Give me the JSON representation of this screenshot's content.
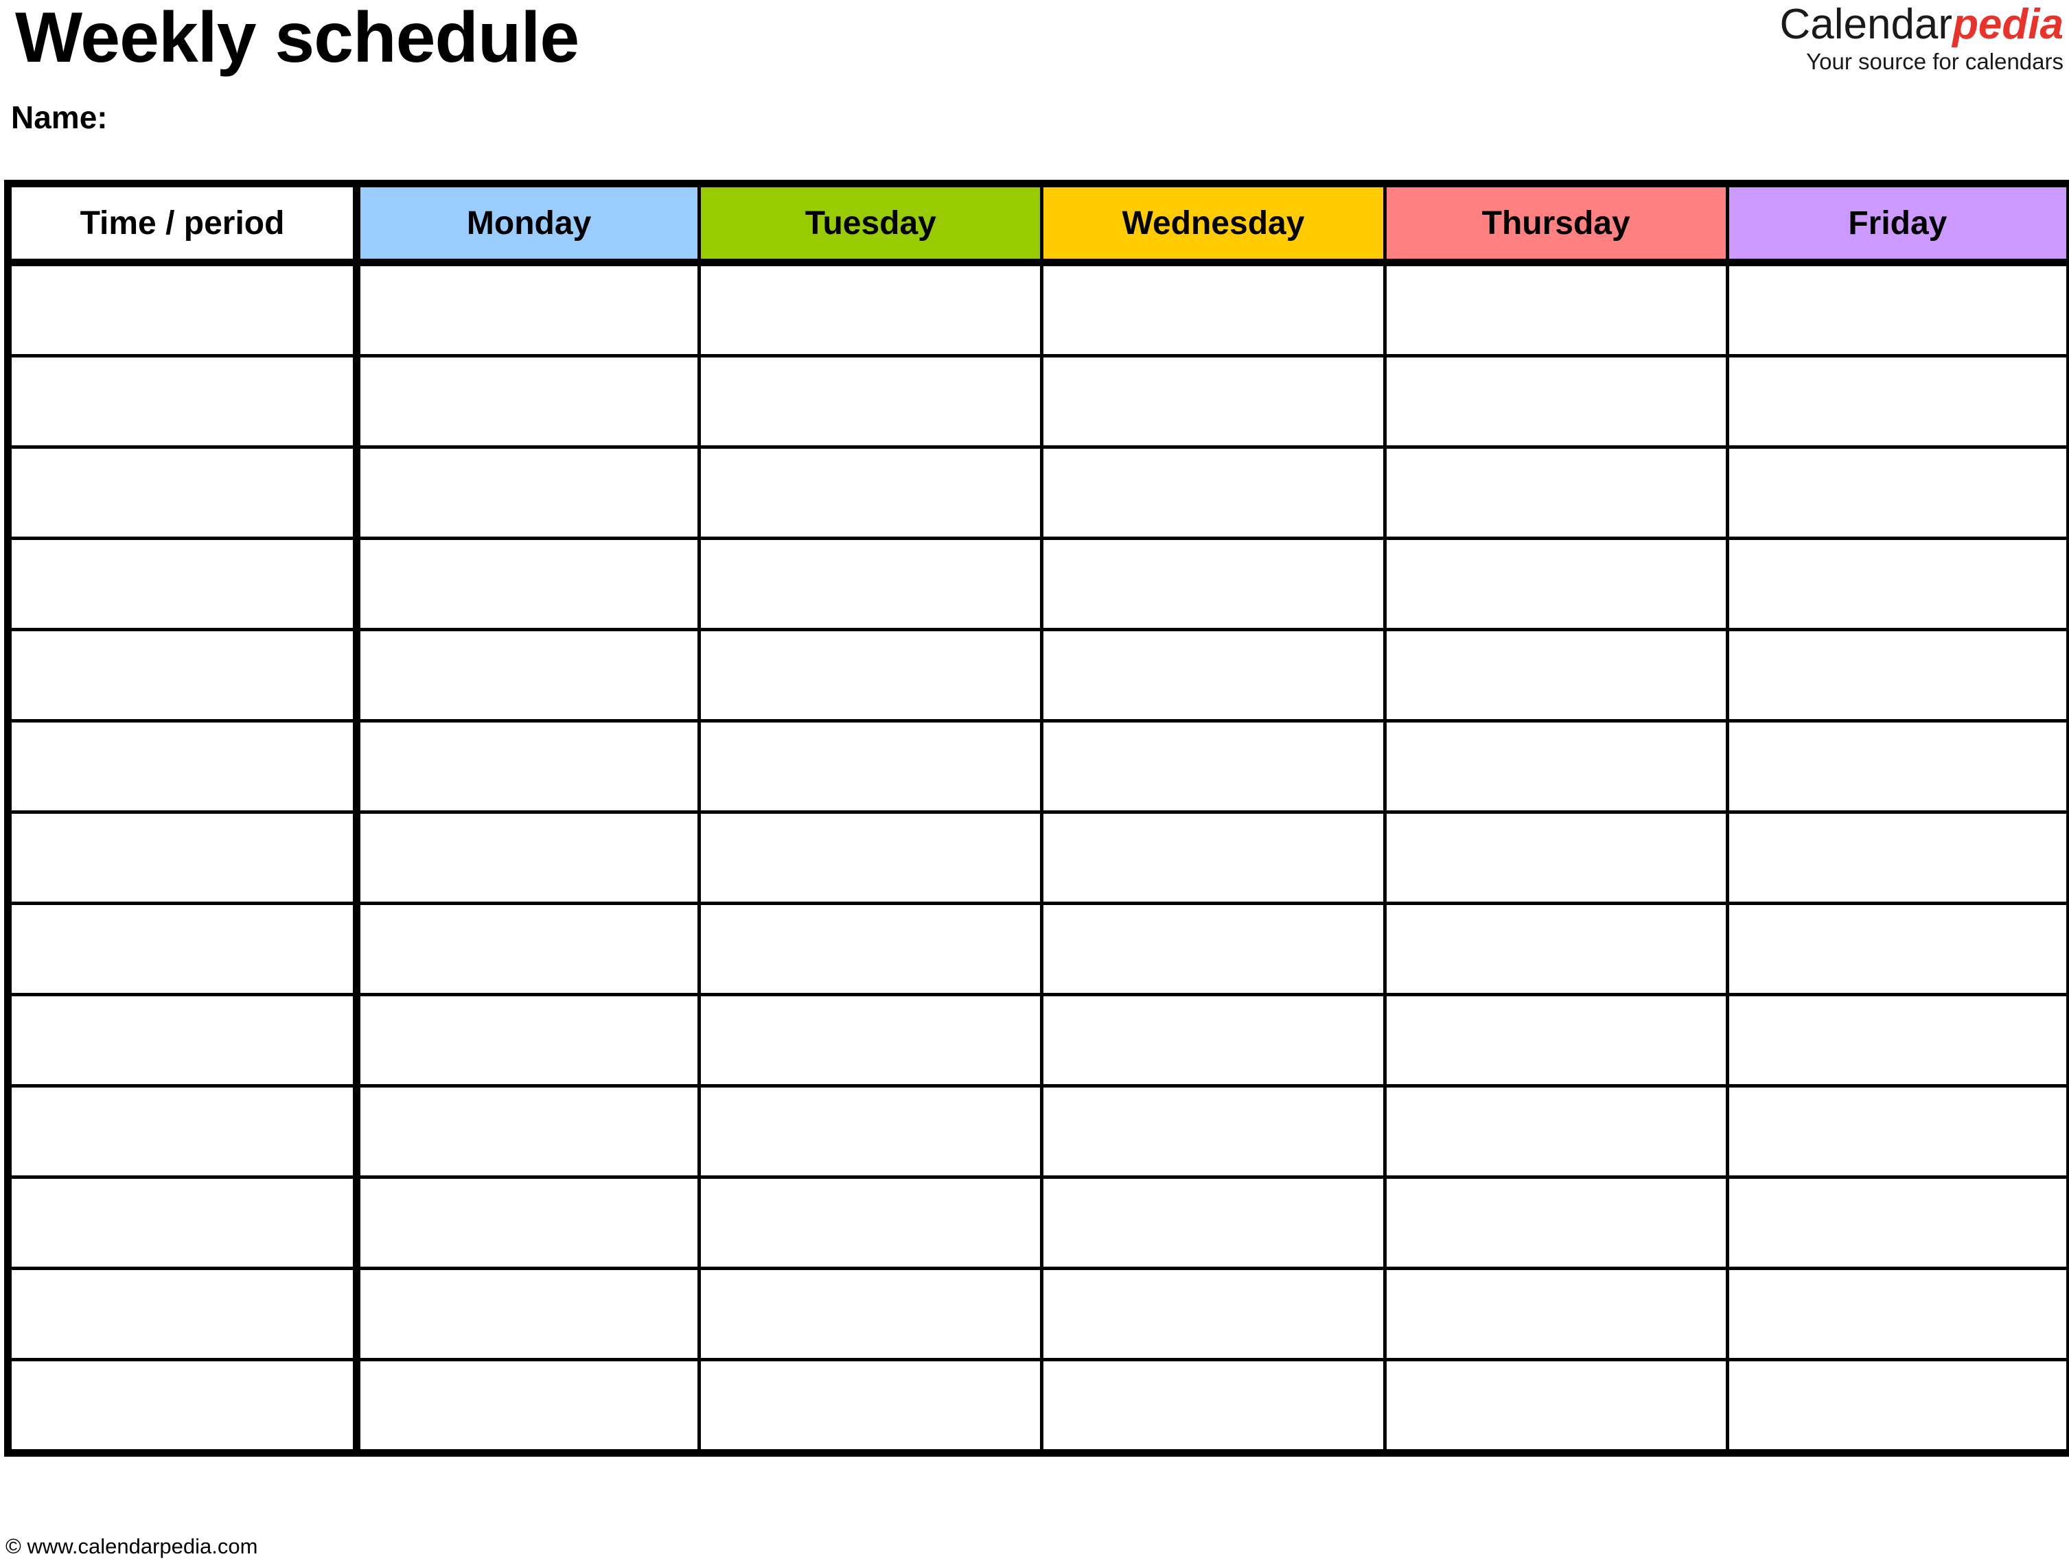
{
  "document": {
    "title": "Weekly schedule",
    "name_label": "Name:"
  },
  "brand": {
    "word_primary": "Calendar",
    "word_accent": "pedia",
    "tagline": "Your source for calendars",
    "accent_color": "#e8322a",
    "primary_color": "#1a1a1a"
  },
  "table": {
    "columns": [
      {
        "label": "Time / period",
        "bg": "#ffffff",
        "key": "time"
      },
      {
        "label": "Monday",
        "bg": "#99ccff",
        "key": "monday"
      },
      {
        "label": "Tuesday",
        "bg": "#99cc00",
        "key": "tuesday"
      },
      {
        "label": "Wednesday",
        "bg": "#ffcc00",
        "key": "wednesday"
      },
      {
        "label": "Thursday",
        "bg": "#ff8080",
        "key": "thursday"
      },
      {
        "label": "Friday",
        "bg": "#cc99ff",
        "key": "friday"
      }
    ],
    "row_count": 13,
    "rows": [
      {
        "time": "",
        "monday": "",
        "tuesday": "",
        "wednesday": "",
        "thursday": "",
        "friday": ""
      },
      {
        "time": "",
        "monday": "",
        "tuesday": "",
        "wednesday": "",
        "thursday": "",
        "friday": ""
      },
      {
        "time": "",
        "monday": "",
        "tuesday": "",
        "wednesday": "",
        "thursday": "",
        "friday": ""
      },
      {
        "time": "",
        "monday": "",
        "tuesday": "",
        "wednesday": "",
        "thursday": "",
        "friday": ""
      },
      {
        "time": "",
        "monday": "",
        "tuesday": "",
        "wednesday": "",
        "thursday": "",
        "friday": ""
      },
      {
        "time": "",
        "monday": "",
        "tuesday": "",
        "wednesday": "",
        "thursday": "",
        "friday": ""
      },
      {
        "time": "",
        "monday": "",
        "tuesday": "",
        "wednesday": "",
        "thursday": "",
        "friday": ""
      },
      {
        "time": "",
        "monday": "",
        "tuesday": "",
        "wednesday": "",
        "thursday": "",
        "friday": ""
      },
      {
        "time": "",
        "monday": "",
        "tuesday": "",
        "wednesday": "",
        "thursday": "",
        "friday": ""
      },
      {
        "time": "",
        "monday": "",
        "tuesday": "",
        "wednesday": "",
        "thursday": "",
        "friday": ""
      },
      {
        "time": "",
        "monday": "",
        "tuesday": "",
        "wednesday": "",
        "thursday": "",
        "friday": ""
      },
      {
        "time": "",
        "monday": "",
        "tuesday": "",
        "wednesday": "",
        "thursday": "",
        "friday": ""
      },
      {
        "time": "",
        "monday": "",
        "tuesday": "",
        "wednesday": "",
        "thursday": "",
        "friday": ""
      }
    ]
  },
  "footer": {
    "copyright": "© www.calendarpedia.com"
  }
}
